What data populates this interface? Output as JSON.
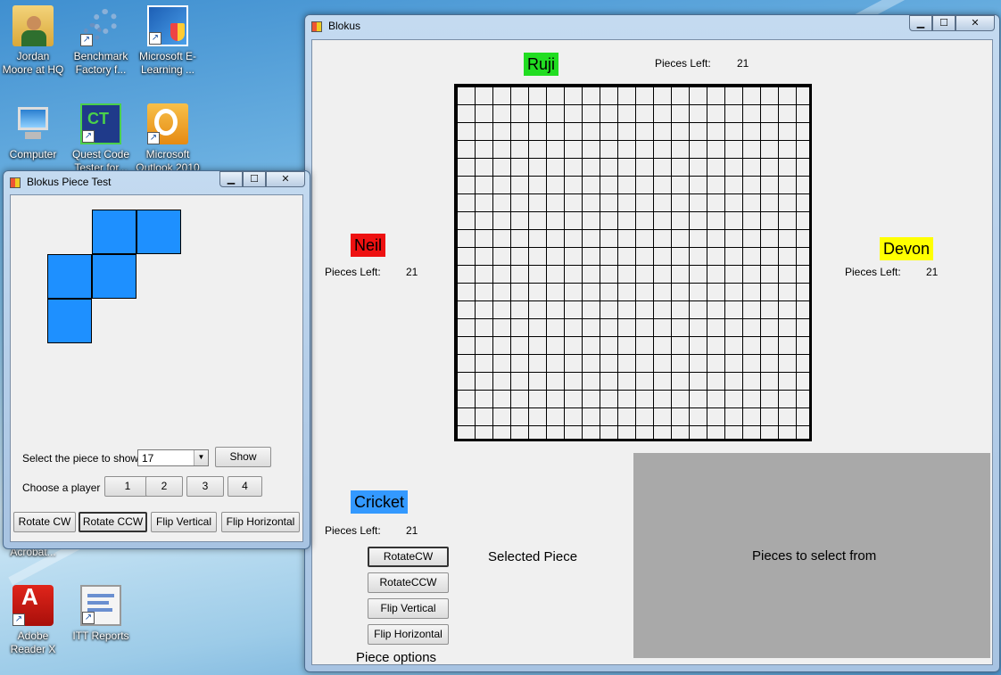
{
  "desktop": {
    "icons": [
      {
        "label": "Jordan Moore at HQ",
        "icon": "user-folder-icon"
      },
      {
        "label": "Benchmark Factory f...",
        "icon": "gears-icon"
      },
      {
        "label": "Microsoft E-Learning ...",
        "icon": "elearning-icon"
      },
      {
        "label": "Computer",
        "icon": "computer-icon"
      },
      {
        "label": "Quest Code Tester for...",
        "icon": "quest-icon"
      },
      {
        "label": "Microsoft Outlook 2010",
        "icon": "outlook-icon"
      },
      {
        "label": "Acrobat...",
        "icon": "acrobat-icon"
      },
      {
        "label": "Adobe Reader X",
        "icon": "adobe-reader-icon"
      },
      {
        "label": "ITT Reports",
        "icon": "reports-icon"
      }
    ]
  },
  "test_window": {
    "title": "Blokus Piece Test",
    "select_label": "Select the piece to show",
    "select_value": "17",
    "show_label": "Show",
    "player_label": "Choose a player",
    "player_buttons": [
      "1",
      "2",
      "3",
      "4"
    ],
    "rotate_cw": "Rotate CW",
    "rotate_ccw": "Rotate CCW",
    "flip_vertical": "Flip Vertical",
    "flip_horizontal": "Flip Horizontal",
    "piece_color": "#1e90ff"
  },
  "main_window": {
    "title": "Blokus",
    "board_size": 20,
    "players": {
      "top": {
        "name": "Ruji",
        "color": "#22dd22",
        "pieces_label": "Pieces Left:",
        "pieces_left": "21"
      },
      "left": {
        "name": "Neil",
        "color": "#ee1111",
        "pieces_label": "Pieces Left:",
        "pieces_left": "21"
      },
      "right": {
        "name": "Devon",
        "color": "#ffff00",
        "pieces_label": "Pieces Left:",
        "pieces_left": "21"
      },
      "bottom": {
        "name": "Cricket",
        "color": "#3399ff",
        "pieces_label": "Pieces Left:",
        "pieces_left": "21"
      }
    },
    "piece_buttons": {
      "rotate_cw": "RotateCW",
      "rotate_ccw": "RotateCCW",
      "flip_vertical": "Flip Vertical",
      "flip_horizontal": "Flip Horizontal"
    },
    "piece_options_label": "Piece options",
    "selected_piece_label": "Selected Piece",
    "pool_label": "Pieces to select from"
  }
}
